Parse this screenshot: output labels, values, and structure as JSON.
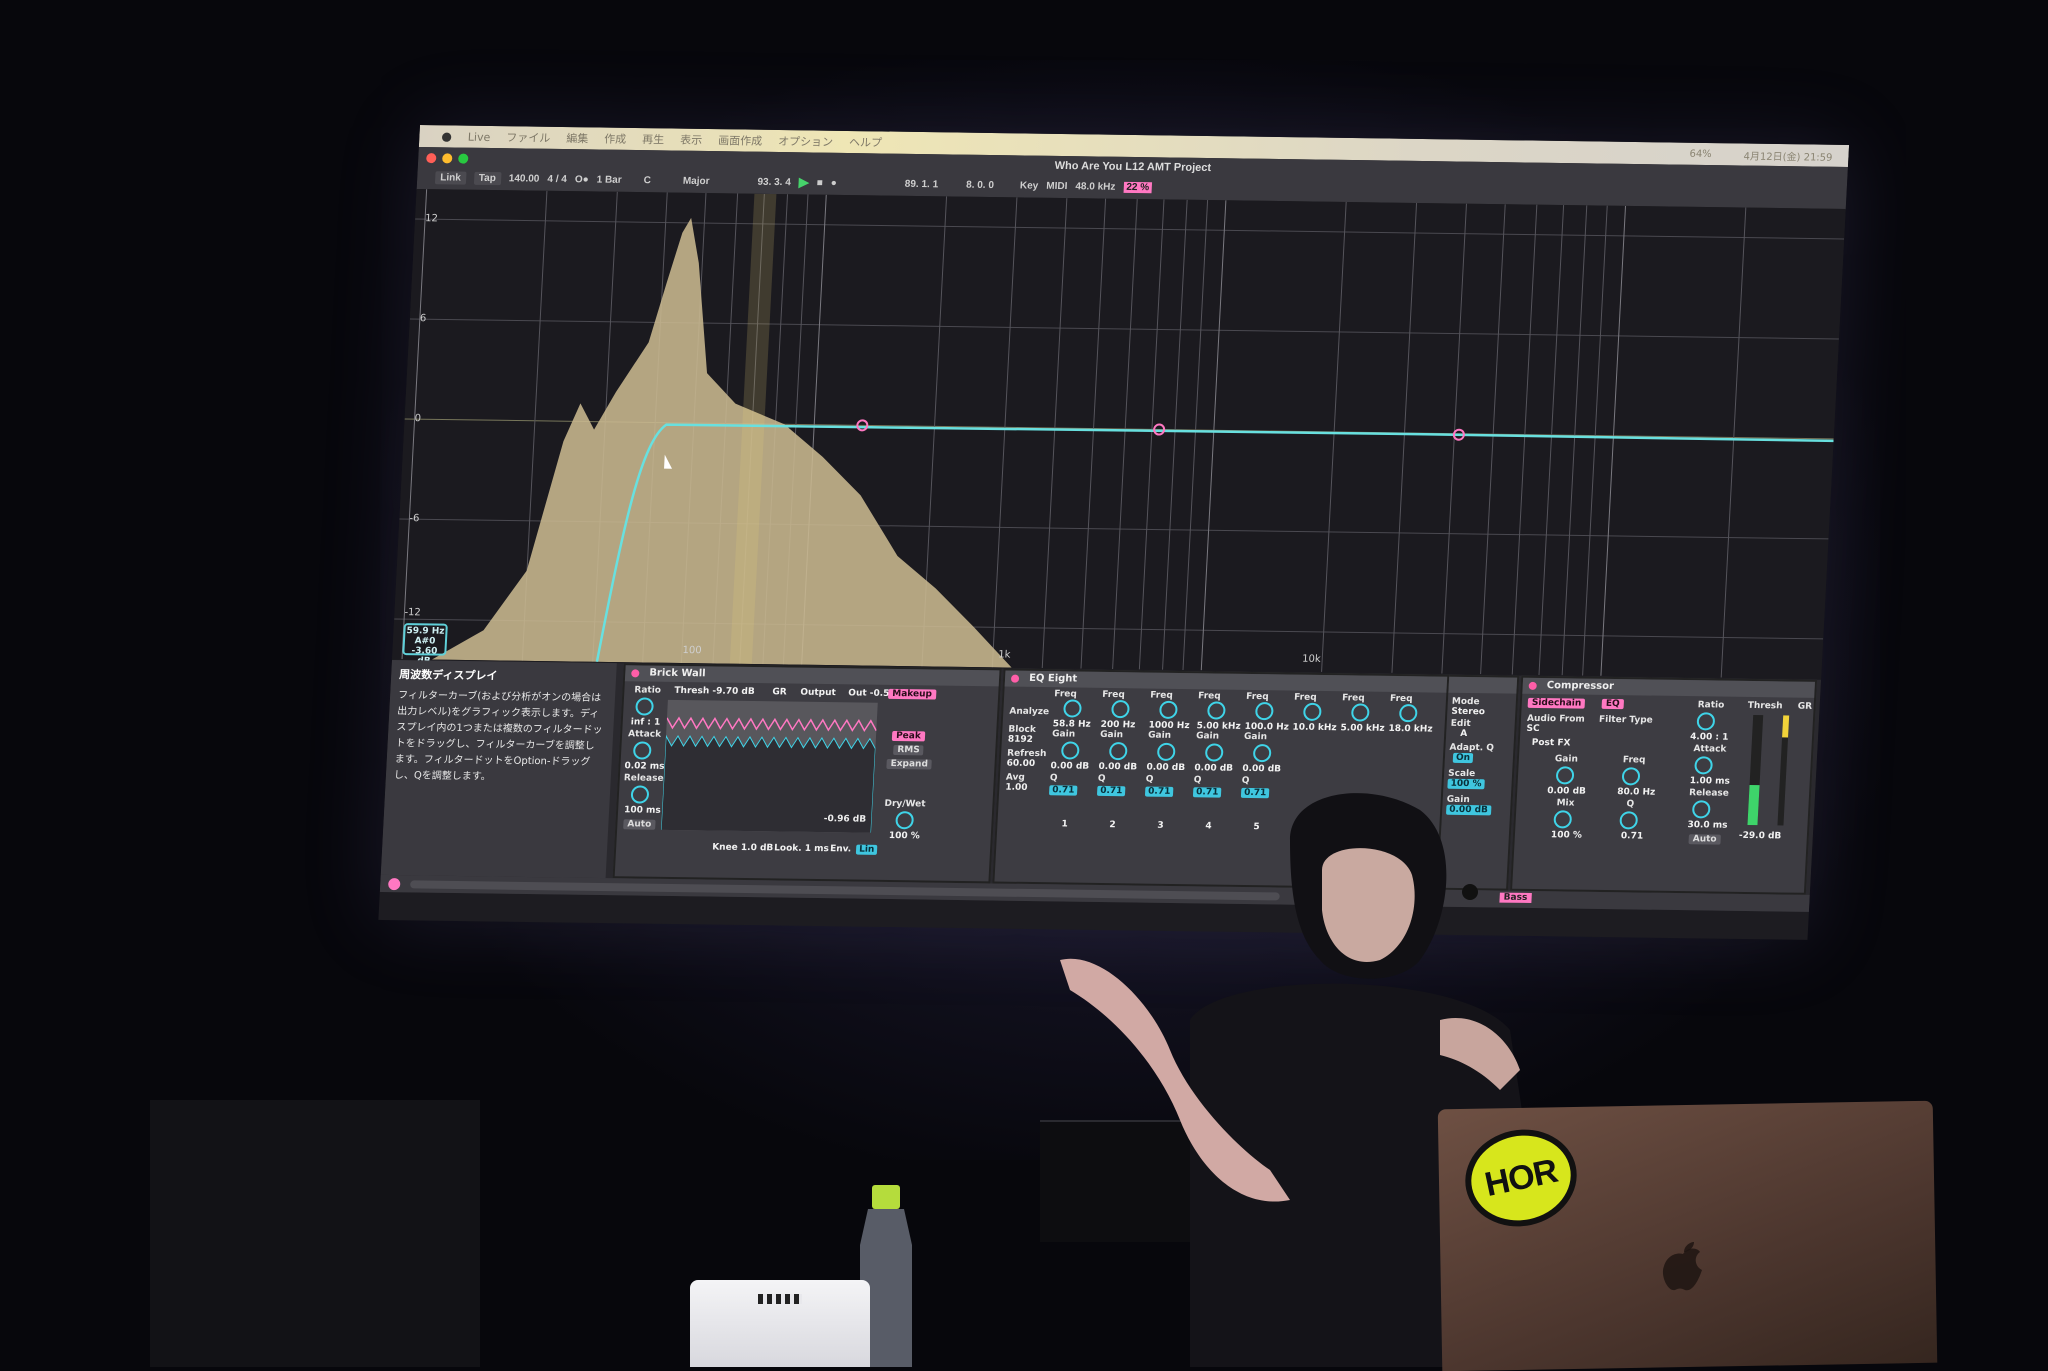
{
  "scene": {
    "description_free": true
  },
  "menubar": {
    "apple": "",
    "items": [
      "Live",
      "ファイル",
      "編集",
      "作成",
      "再生",
      "表示",
      "画面作成",
      "オプション",
      "ヘルプ"
    ],
    "status": "4月12日(金) 21:59",
    "battery": "64%"
  },
  "window": {
    "title": "Who Are You L12 AMT Project"
  },
  "toolbar": {
    "link": "Link",
    "tap": "Tap",
    "tempo": "140.00",
    "signature": "4 / 4",
    "metronome": "O●",
    "quantize": "1 Bar",
    "key": "C",
    "scale": "Major",
    "position": "93. 3. 4",
    "loop_start": "89. 1. 1",
    "loop_len": "8. 0. 0",
    "key_btn": "Key",
    "midi_btn": "MIDI",
    "sample_rate": "48.0 kHz",
    "cpu": "22 %"
  },
  "eq_display": {
    "db_ticks": [
      "12",
      "6",
      "0",
      "-6",
      "-12"
    ],
    "freq_ticks": [
      "100",
      "1k",
      "10k"
    ],
    "readout": {
      "freq": "59.9 Hz",
      "note": "A#0",
      "gain": "-3.60 dB"
    }
  },
  "info_panel": {
    "title": "周波数ディスプレイ",
    "body": "フィルターカーブ(および分析がオンの場合は出力レベル)をグラフィック表示します。ディスプレイ内の1つまたは複数のフィルタードットをドラッグし、フィルターカーブを調整します。フィルタードットをOption-ドラッグし、Qを調整します。"
  },
  "brick_wall": {
    "title": "Brick Wall",
    "ratio_label": "Ratio",
    "ratio_value": "inf : 1",
    "attack_label": "Attack",
    "attack_value": "0.02 ms",
    "release_label": "Release",
    "release_value": "100 ms",
    "auto": "Auto",
    "thresh": "Thresh -9.70 dB",
    "gr": "GR",
    "output": "Output",
    "out": "Out -0.50 dB",
    "makeup": "Makeup",
    "peak": "Peak",
    "rms": "RMS",
    "expand": "Expand",
    "meter_value": "-0.96 dB",
    "drywet_label": "Dry/Wet",
    "drywet_value": "100 %",
    "knee": "Knee 1.0 dB",
    "look": "Look. 1 ms",
    "env": "Env.",
    "env_value": "Lin"
  },
  "eq_eight": {
    "title": "EQ Eight",
    "analyze": "Analyze",
    "block_label": "Block",
    "block_value": "8192",
    "refresh_label": "Refresh",
    "refresh_value": "60.00",
    "avg_label": "Avg",
    "avg_value": "1.00",
    "bands": [
      {
        "freq": "58.8 Hz",
        "gain": "0.00 dB",
        "q": "0.71",
        "num": "1"
      },
      {
        "freq": "200 Hz",
        "gain": "0.00 dB",
        "q": "0.71",
        "num": "2"
      },
      {
        "freq": "1000 Hz",
        "gain": "0.00 dB",
        "q": "0.71",
        "num": "3"
      },
      {
        "freq": "5.00 kHz",
        "gain": "0.00 dB",
        "q": "0.71",
        "num": "4"
      },
      {
        "freq": "100.0 Hz",
        "gain": "0.00 dB",
        "q": "0.71",
        "num": "5"
      },
      {
        "freq": "10.0 kHz",
        "gain": "",
        "q": "",
        "num": ""
      },
      {
        "freq": "5.00 kHz",
        "gain": "",
        "q": "",
        "num": ""
      },
      {
        "freq": "18.0 kHz",
        "gain": "",
        "q": "",
        "num": ""
      }
    ],
    "freq_label": "Freq",
    "gain_label": "Gain",
    "q_label": "Q",
    "mode_label": "Mode",
    "mode_value": "Stereo",
    "edit_label": "Edit",
    "edit_value": "A",
    "adapt_label": "Adapt. Q",
    "adapt_value": "On",
    "scale_label": "Scale",
    "scale_value": "100 %",
    "gain_out_label": "Gain",
    "gain_out_value": "0.00 dB"
  },
  "compressor": {
    "title": "Compressor",
    "sidechain": "Sidechain",
    "eq_btn": "EQ",
    "audio_from_label": "Audio From",
    "audio_from_value": "SC",
    "post_fx": "Post FX",
    "filter_type_label": "Filter Type",
    "gain_label": "Gain",
    "gain_value": "0.00 dB",
    "mix_label": "Mix",
    "mix_value": "100 %",
    "freq_label": "Freq",
    "freq_value": "80.0 Hz",
    "q_label": "Q",
    "q_value": "0.71",
    "ratio_label": "Ratio",
    "ratio_value": "4.00 : 1",
    "attack_label": "Attack",
    "attack_value": "1.00 ms",
    "release_label": "Release",
    "release_value": "30.0 ms",
    "auto": "Auto",
    "thresh_label": "Thresh",
    "thresh_value": "-29.0 dB",
    "gr_label": "GR"
  },
  "bottom_bar": {
    "track": "Bass"
  },
  "sticker": {
    "text": "HOR"
  },
  "colors": {
    "accent_pink": "#ff78c2",
    "accent_cyan": "#3fd4e8",
    "spectrum": "#c9b890",
    "eq_curve": "#68e0df"
  }
}
